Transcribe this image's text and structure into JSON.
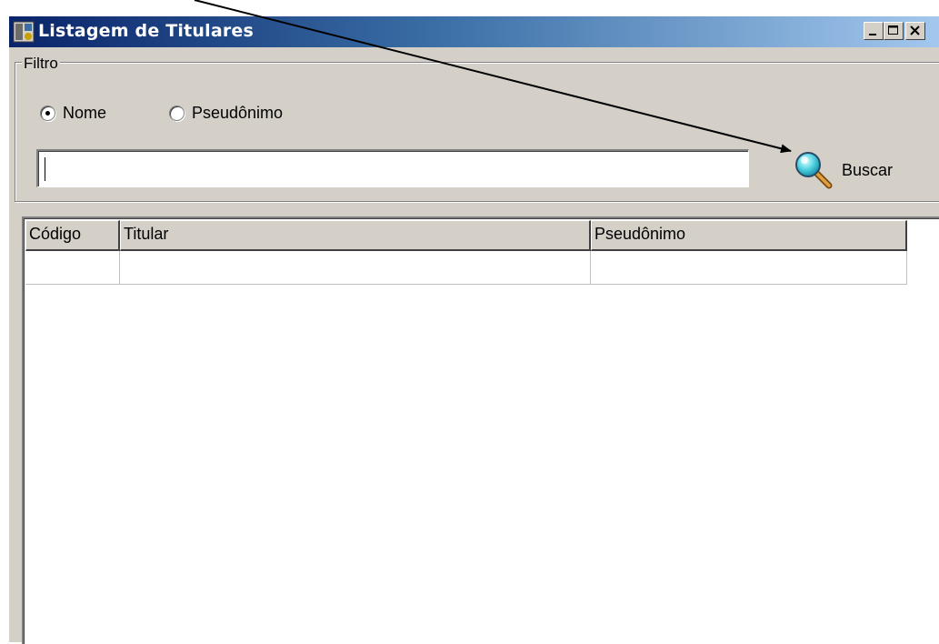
{
  "window": {
    "title": "Listagem de Titulares"
  },
  "filter": {
    "legend": "Filtro",
    "radio_nome": {
      "label": "Nome",
      "checked": true
    },
    "radio_pseudonimo": {
      "label": "Pseudônimo",
      "checked": false
    },
    "search_value": "",
    "search_button_label": "Buscar"
  },
  "grid": {
    "columns": [
      "Código",
      "Titular",
      "Pseudônimo"
    ],
    "rows": [
      [
        "",
        "",
        ""
      ]
    ]
  },
  "colors": {
    "face": "#d4d0c8",
    "title_start": "#0a246a",
    "title_end": "#a6caf0",
    "annotation_arrow": "#000000"
  },
  "icons": {
    "app": "app-icon",
    "search": "magnifier-icon",
    "minimize": "minimize-icon",
    "maximize": "maximize-icon",
    "close": "close-icon"
  }
}
